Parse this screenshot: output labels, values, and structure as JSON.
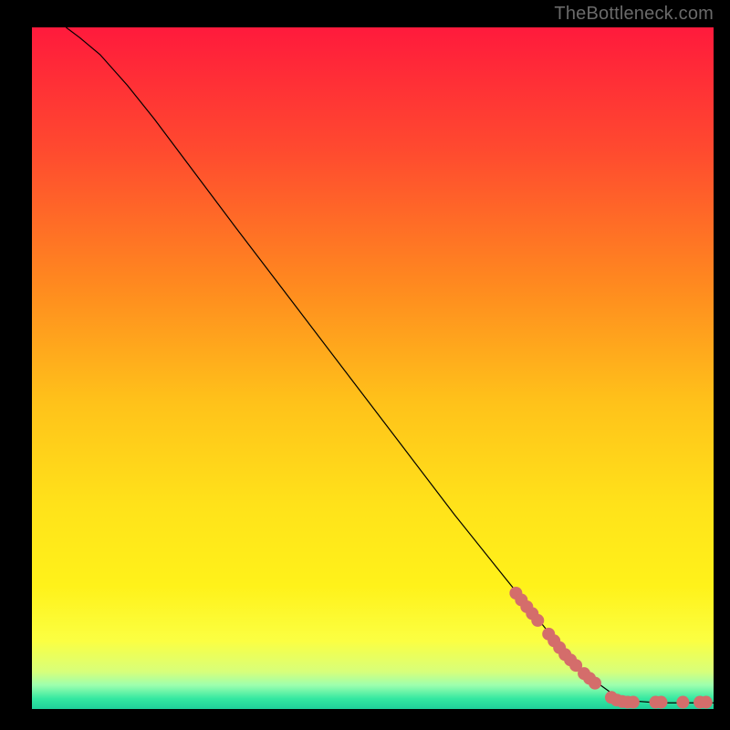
{
  "watermark": "TheBottleneck.com",
  "chart_data": {
    "type": "line",
    "title": "",
    "xlabel": "",
    "ylabel": "",
    "xlim": [
      0,
      100
    ],
    "ylim": [
      0,
      100
    ],
    "grid": false,
    "legend": false,
    "background_gradient": {
      "stops": [
        {
          "offset": 0.0,
          "color": "#ff1a3c"
        },
        {
          "offset": 0.18,
          "color": "#ff4a2f"
        },
        {
          "offset": 0.38,
          "color": "#ff8a1f"
        },
        {
          "offset": 0.55,
          "color": "#ffc21a"
        },
        {
          "offset": 0.7,
          "color": "#ffe21a"
        },
        {
          "offset": 0.82,
          "color": "#fff21a"
        },
        {
          "offset": 0.9,
          "color": "#fbff42"
        },
        {
          "offset": 0.945,
          "color": "#d8ff7a"
        },
        {
          "offset": 0.965,
          "color": "#9dffae"
        },
        {
          "offset": 0.985,
          "color": "#34e8a1"
        },
        {
          "offset": 1.0,
          "color": "#1fcf9a"
        }
      ]
    },
    "curve": {
      "color": "#000000",
      "width": 1.2,
      "points": [
        {
          "x": 5.0,
          "y": 100.0
        },
        {
          "x": 7.0,
          "y": 98.5
        },
        {
          "x": 10.0,
          "y": 96.0
        },
        {
          "x": 14.0,
          "y": 91.5
        },
        {
          "x": 18.0,
          "y": 86.5
        },
        {
          "x": 24.0,
          "y": 78.5
        },
        {
          "x": 30.0,
          "y": 70.5
        },
        {
          "x": 38.0,
          "y": 60.0
        },
        {
          "x": 46.0,
          "y": 49.5
        },
        {
          "x": 54.0,
          "y": 39.0
        },
        {
          "x": 62.0,
          "y": 28.5
        },
        {
          "x": 70.0,
          "y": 18.5
        },
        {
          "x": 76.0,
          "y": 11.0
        },
        {
          "x": 80.0,
          "y": 6.5
        },
        {
          "x": 83.0,
          "y": 3.8
        },
        {
          "x": 85.5,
          "y": 2.0
        },
        {
          "x": 88.0,
          "y": 1.2
        },
        {
          "x": 92.0,
          "y": 0.9
        },
        {
          "x": 96.0,
          "y": 0.9
        },
        {
          "x": 100.0,
          "y": 0.9
        }
      ]
    },
    "series": [
      {
        "name": "markers",
        "type": "scatter",
        "color": "#d46d6b",
        "radius": 7,
        "points": [
          {
            "x": 71.0,
            "y": 17.0
          },
          {
            "x": 71.8,
            "y": 16.0
          },
          {
            "x": 72.6,
            "y": 15.0
          },
          {
            "x": 73.4,
            "y": 14.0
          },
          {
            "x": 74.2,
            "y": 13.0
          },
          {
            "x": 75.8,
            "y": 11.0
          },
          {
            "x": 76.6,
            "y": 10.0
          },
          {
            "x": 77.4,
            "y": 9.0
          },
          {
            "x": 78.2,
            "y": 8.0
          },
          {
            "x": 79.0,
            "y": 7.2
          },
          {
            "x": 79.8,
            "y": 6.4
          },
          {
            "x": 81.0,
            "y": 5.2
          },
          {
            "x": 81.8,
            "y": 4.5
          },
          {
            "x": 82.6,
            "y": 3.8
          },
          {
            "x": 85.0,
            "y": 1.7
          },
          {
            "x": 85.8,
            "y": 1.3
          },
          {
            "x": 86.6,
            "y": 1.1
          },
          {
            "x": 87.4,
            "y": 1.0
          },
          {
            "x": 88.2,
            "y": 1.0
          },
          {
            "x": 91.5,
            "y": 1.0
          },
          {
            "x": 92.3,
            "y": 1.0
          },
          {
            "x": 95.5,
            "y": 1.0
          },
          {
            "x": 98.0,
            "y": 1.0
          },
          {
            "x": 98.9,
            "y": 1.0
          }
        ]
      }
    ]
  }
}
